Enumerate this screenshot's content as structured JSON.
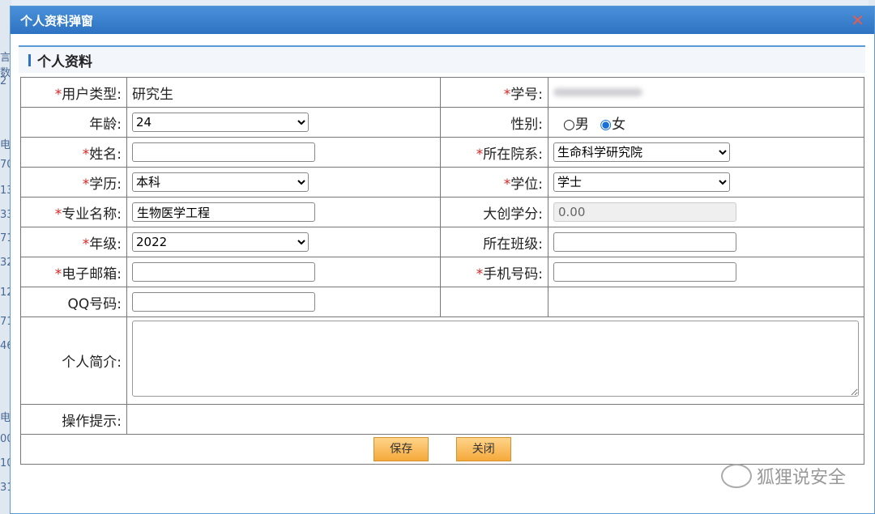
{
  "window": {
    "title": "个人资料弹窗",
    "close_label": "✕"
  },
  "section": {
    "title": "个人资料"
  },
  "fields": {
    "user_type": {
      "label": "用户类型:",
      "value": "研究生"
    },
    "student_no": {
      "label": "学号:"
    },
    "age": {
      "label": "年龄:",
      "value": "24"
    },
    "gender": {
      "label": "性别:",
      "male": "男",
      "female": "女",
      "selected": "女"
    },
    "name": {
      "label": "姓名:"
    },
    "department": {
      "label": "所在院系:",
      "value": "生命科学研究院"
    },
    "education": {
      "label": "学历:",
      "value": "本科"
    },
    "degree": {
      "label": "学位:",
      "value": "学士"
    },
    "major": {
      "label": "专业名称:",
      "value": "生物医学工程"
    },
    "credits": {
      "label": "大创学分:",
      "value": "0.00"
    },
    "grade": {
      "label": "年级:",
      "value": "2022"
    },
    "class": {
      "label": "所在班级:"
    },
    "email": {
      "label": "电子邮箱:"
    },
    "phone": {
      "label": "手机号码:"
    },
    "qq": {
      "label": "QQ号码:"
    },
    "bio": {
      "label": "个人简介:"
    },
    "tips": {
      "label": "操作提示:"
    }
  },
  "buttons": {
    "save": "保存",
    "close": "关闭"
  },
  "required_mark": "*",
  "background_fragments": [
    "言数",
    "2",
    "电",
    "70",
    "13",
    "33",
    "71",
    "32",
    "12",
    "71",
    "46",
    "电",
    "00",
    "10",
    "31"
  ],
  "watermark": {
    "text": "狐狸说安全"
  }
}
